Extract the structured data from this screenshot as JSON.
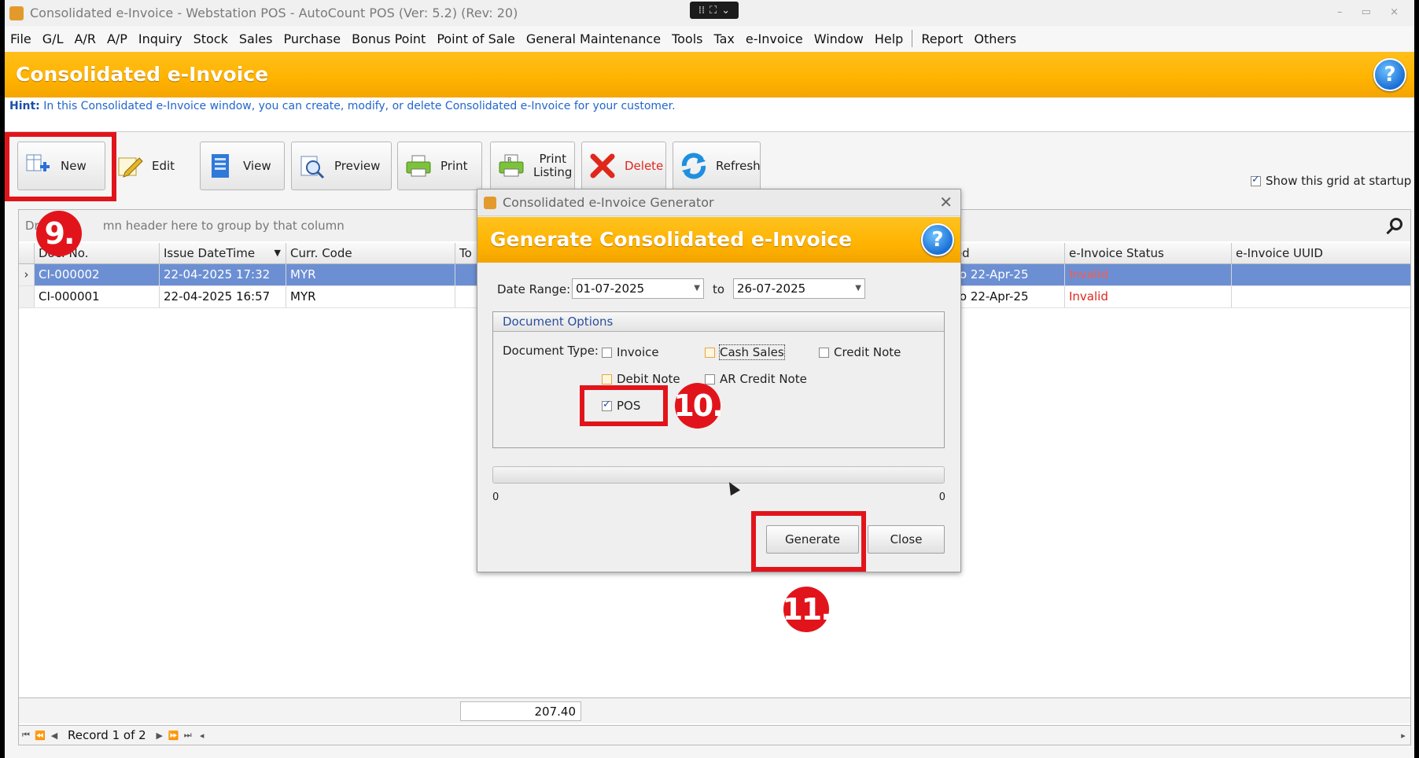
{
  "window": {
    "title": "Consolidated e-Invoice - Webstation POS - AutoCount POS (Ver: 5.2) (Rev: 20)",
    "controls": "–  ▭  ×"
  },
  "menu": [
    "File",
    "G/L",
    "A/R",
    "A/P",
    "Inquiry",
    "Stock",
    "Sales",
    "Purchase",
    "Bonus Point",
    "Point of Sale",
    "General Maintenance",
    "Tools",
    "Tax",
    "e-Invoice",
    "Window",
    "Help"
  ],
  "menu_right": [
    "Report",
    "Others"
  ],
  "header": {
    "title": "Consolidated e-Invoice",
    "help": "?"
  },
  "hint": {
    "label": "Hint:",
    "text": "In this Consolidated e-Invoice window, you can create, modify, or delete Consolidated e-Invoice for your customer."
  },
  "toolbar": {
    "new": "New",
    "edit": "Edit",
    "view": "View",
    "preview": "Preview",
    "print": "Print",
    "print_listing_1": "Print",
    "print_listing_2": "Listing",
    "delete": "Delete",
    "refresh": "Refresh"
  },
  "show_grid_startup": {
    "label": "Show this grid at startup",
    "checked": true
  },
  "grid": {
    "group_hint_a": "Dra",
    "group_hint_b": "mn header here to group by that column",
    "columns": [
      "Doc. No.",
      "Issue DateTime",
      "Curr. Code",
      "To",
      "od",
      "e-Invoice Status",
      "e-Invoice UUID"
    ],
    "rows": [
      {
        "doc": "CI-000002",
        "datetime": "22-04-2025 17:32",
        "curr": "MYR",
        "period": "to 22-Apr-25",
        "status": "Invalid",
        "uuid": ""
      },
      {
        "doc": "CI-000001",
        "datetime": "22-04-2025 16:57",
        "curr": "MYR",
        "period": "to 22-Apr-25",
        "status": "Invalid",
        "uuid": ""
      }
    ],
    "total": "207.40",
    "record_nav": "Record 1 of 2"
  },
  "dialog": {
    "title": "Consolidated e-Invoice Generator",
    "header": "Generate Consolidated e-Invoice",
    "help": "?",
    "date_range_label": "Date Range:",
    "date_from": "01-07-2025",
    "to_label": "to",
    "date_to": "26-07-2025",
    "doc_options_title": "Document Options",
    "doc_type_label": "Document Type:",
    "options": {
      "invoice": {
        "label": "Invoice",
        "checked": false
      },
      "cash_sales": {
        "label": "Cash Sales",
        "checked": false
      },
      "credit_note": {
        "label": "Credit Note",
        "checked": false
      },
      "debit_note": {
        "label": "Debit Note",
        "checked": false
      },
      "ar_credit_note": {
        "label": "AR Credit Note",
        "checked": false
      },
      "pos": {
        "label": "POS",
        "checked": true
      }
    },
    "progress_min": "0",
    "progress_max": "0",
    "generate": "Generate",
    "close": "Close"
  },
  "annotations": {
    "step9": "9.",
    "step10": "10.",
    "step11": "11."
  },
  "colors": {
    "accent_orange": "#ffb300",
    "highlight_red": "#e2141b",
    "selected_row": "#6c8fd3",
    "status_invalid": "#e0271c"
  }
}
